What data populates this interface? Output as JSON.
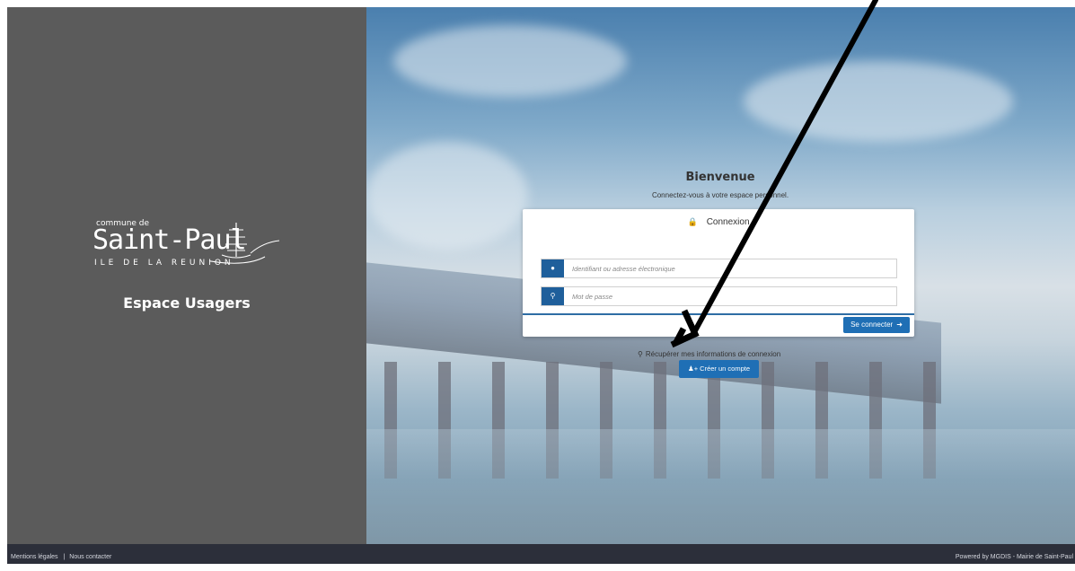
{
  "sidebar": {
    "logo": {
      "line1": "commune de",
      "name": "Saint-Paul",
      "line3": "ILE DE LA REUNION"
    },
    "title": "Espace Usagers",
    "background": "#5b5b5b"
  },
  "welcome": {
    "title": "Bienvenue",
    "subtitle": "Connectez-vous à votre espace personnel."
  },
  "login": {
    "header": "Connexion",
    "header_icon": "lock-icon",
    "username_placeholder": "Identifiant ou adresse électronique",
    "username_icon": "user-icon",
    "password_placeholder": "Mot de passe",
    "password_icon": "key-icon",
    "submit_label": "Se connecter",
    "submit_icon": "sign-in-icon"
  },
  "recover_label": "Récupérer mes informations de connexion",
  "create_account_label": "Créer un compte",
  "footer": {
    "legal": "Mentions légales",
    "separator": "|",
    "contact": "Nous contacter",
    "powered": "Powered by MGDIS - Mairie de Saint-Paul"
  },
  "colors": {
    "accent": "#1f6fb5",
    "footer": "#2c2f3a"
  }
}
